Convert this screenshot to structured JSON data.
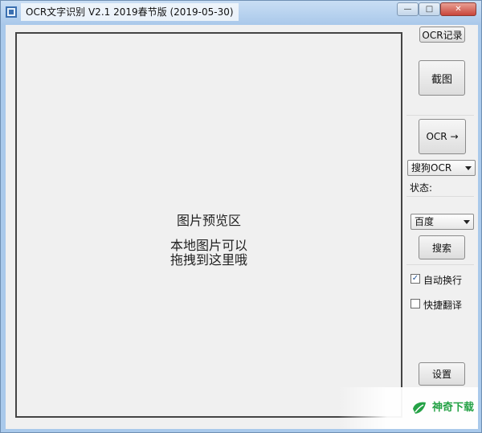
{
  "window": {
    "title": "OCR文字识别 V2.1   2019春节版 (2019-05-30)",
    "minimize_glyph": "—",
    "maximize_glyph": "□",
    "close_glyph": "✕"
  },
  "preview": {
    "title": "图片预览区",
    "hint_line1": "本地图片可以",
    "hint_line2": "拖拽到这里哦"
  },
  "sidebar": {
    "ocr_history_label": "OCR记录",
    "screenshot_label": "截图",
    "ocr_run_label": "OCR →",
    "ocr_engine_selected": "搜狗OCR",
    "status_label": "状态:",
    "search_engine_selected": "百度",
    "search_label": "搜索",
    "auto_wrap_label": "自动换行",
    "auto_wrap_checked": true,
    "check_glyph": "✓",
    "quick_translate_label": "快捷翻译",
    "quick_translate_checked": false,
    "settings_label": "设置"
  },
  "watermark": {
    "text": "神奇下载",
    "icon": "leaf-logo-icon",
    "color": "#25a246"
  },
  "colors": {
    "titlebar": "#a9c9eb",
    "client_bg": "#f0f0f0",
    "close_button": "#c8453a"
  }
}
